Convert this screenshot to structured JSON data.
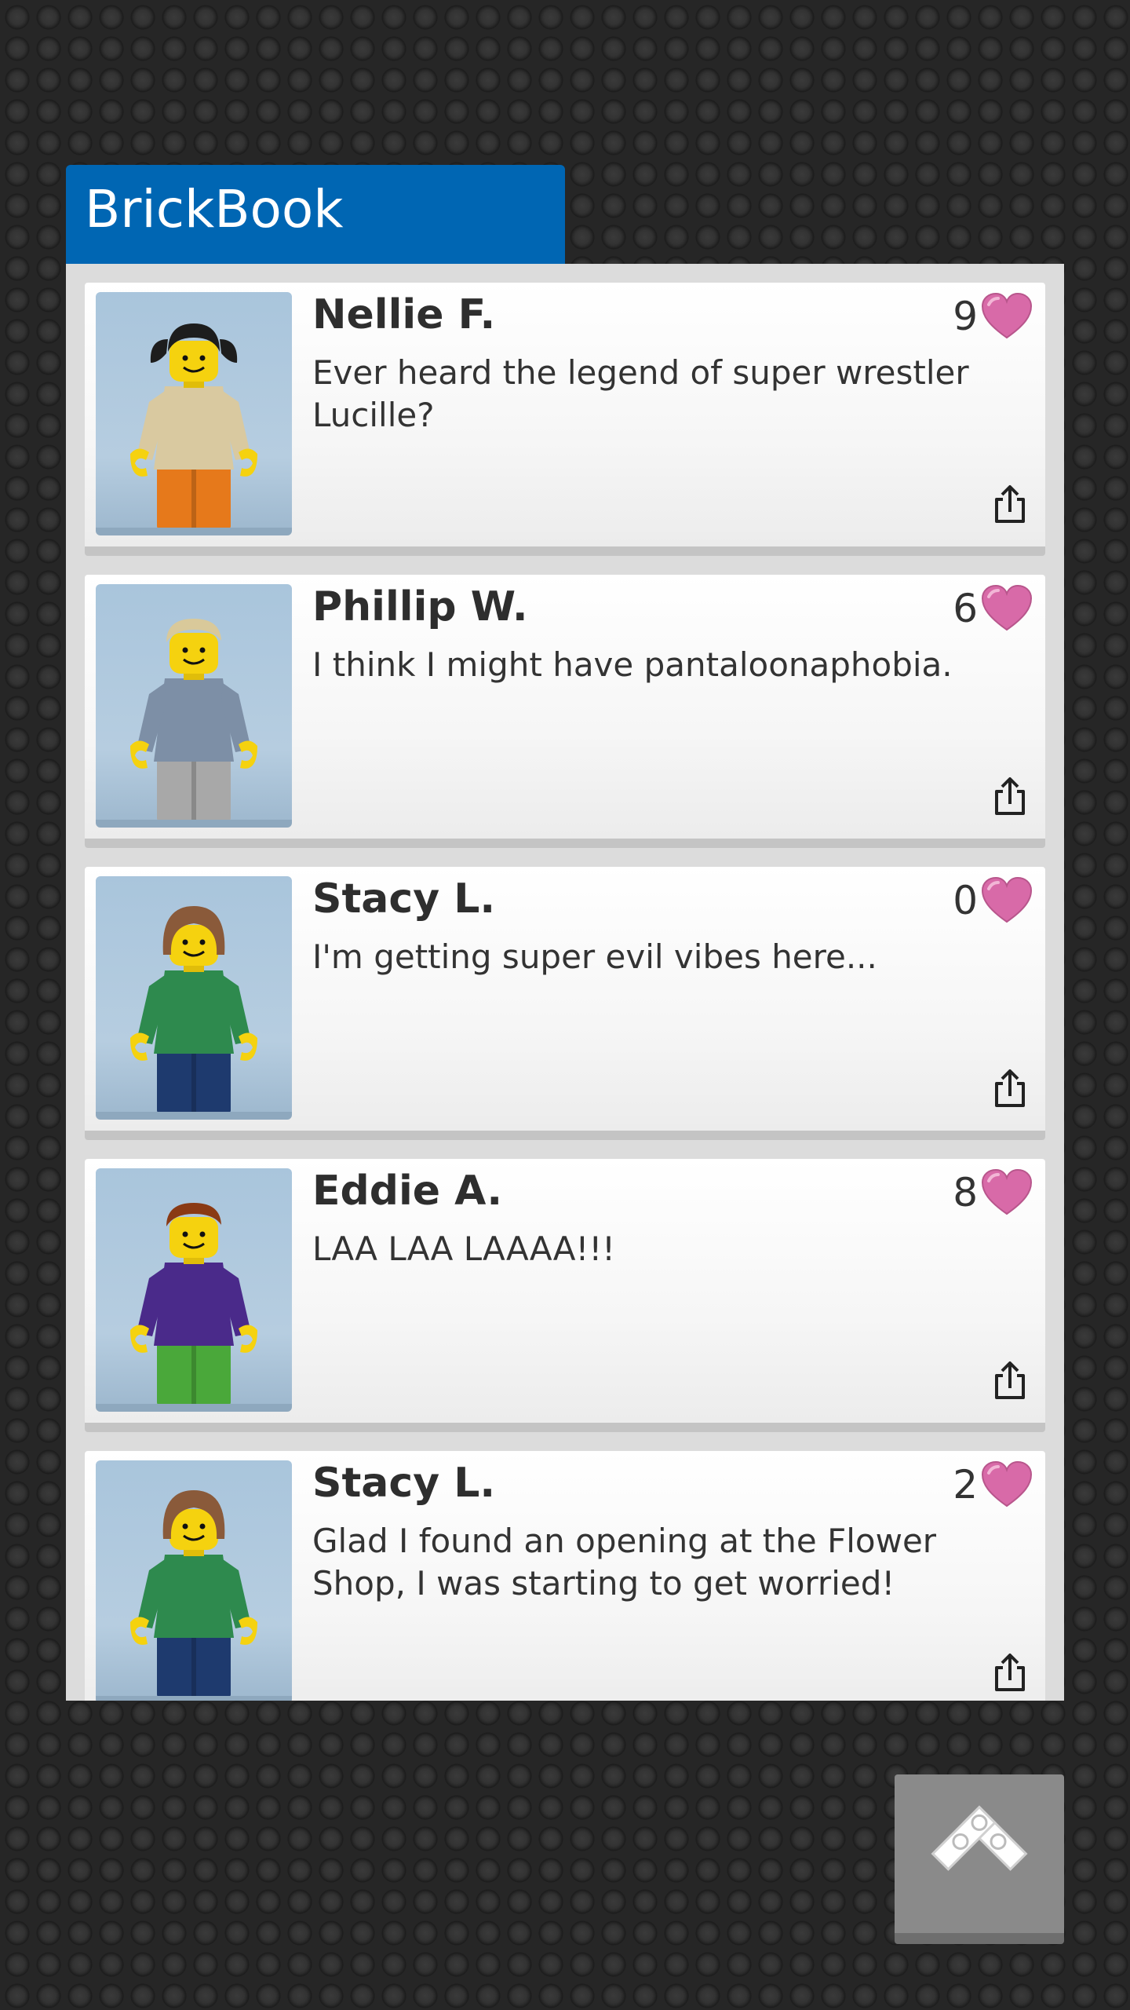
{
  "app": {
    "title": "BrickBook"
  },
  "posts": [
    {
      "author": "Nellie F.",
      "message": "Ever heard the legend of super wrestler Lucille?",
      "likes": "9",
      "avatar": {
        "hair": "#1d1d1d",
        "torso": "#d9c9a0",
        "legs": "#e6791b",
        "hair_style": "pigtails"
      }
    },
    {
      "author": "Phillip W.",
      "message": "I think I might have pantaloonaphobia.",
      "likes": "6",
      "avatar": {
        "hair": "#d9c99a",
        "torso": "#7d8fa6",
        "legs": "#a8a8a8",
        "hair_style": "short"
      }
    },
    {
      "author": "Stacy L.",
      "message": "I'm getting super evil vibes here...",
      "likes": "0",
      "avatar": {
        "hair": "#8a5a3a",
        "torso": "#2e8a4e",
        "legs": "#1e3a6e",
        "hair_style": "bob"
      }
    },
    {
      "author": "Eddie A.",
      "message": "LAA LAA LAAAA!!!",
      "likes": "8",
      "avatar": {
        "hair": "#8a3a14",
        "torso": "#4a2a8a",
        "legs": "#4aa83a",
        "hair_style": "short"
      }
    },
    {
      "author": "Stacy L.",
      "message": "Glad I found an opening at the Flower Shop, I was starting to get worried!",
      "likes": "2",
      "avatar": {
        "hair": "#8a5a3a",
        "torso": "#2e8a4e",
        "legs": "#1e3a6e",
        "hair_style": "bob"
      }
    }
  ],
  "colors": {
    "brand": "#0066b3",
    "heart": "#d86aa8",
    "back_button": "#8a8a8a"
  },
  "icons": {
    "like": "heart-icon",
    "share": "share-icon",
    "back": "brick-back-arrow-icon"
  }
}
